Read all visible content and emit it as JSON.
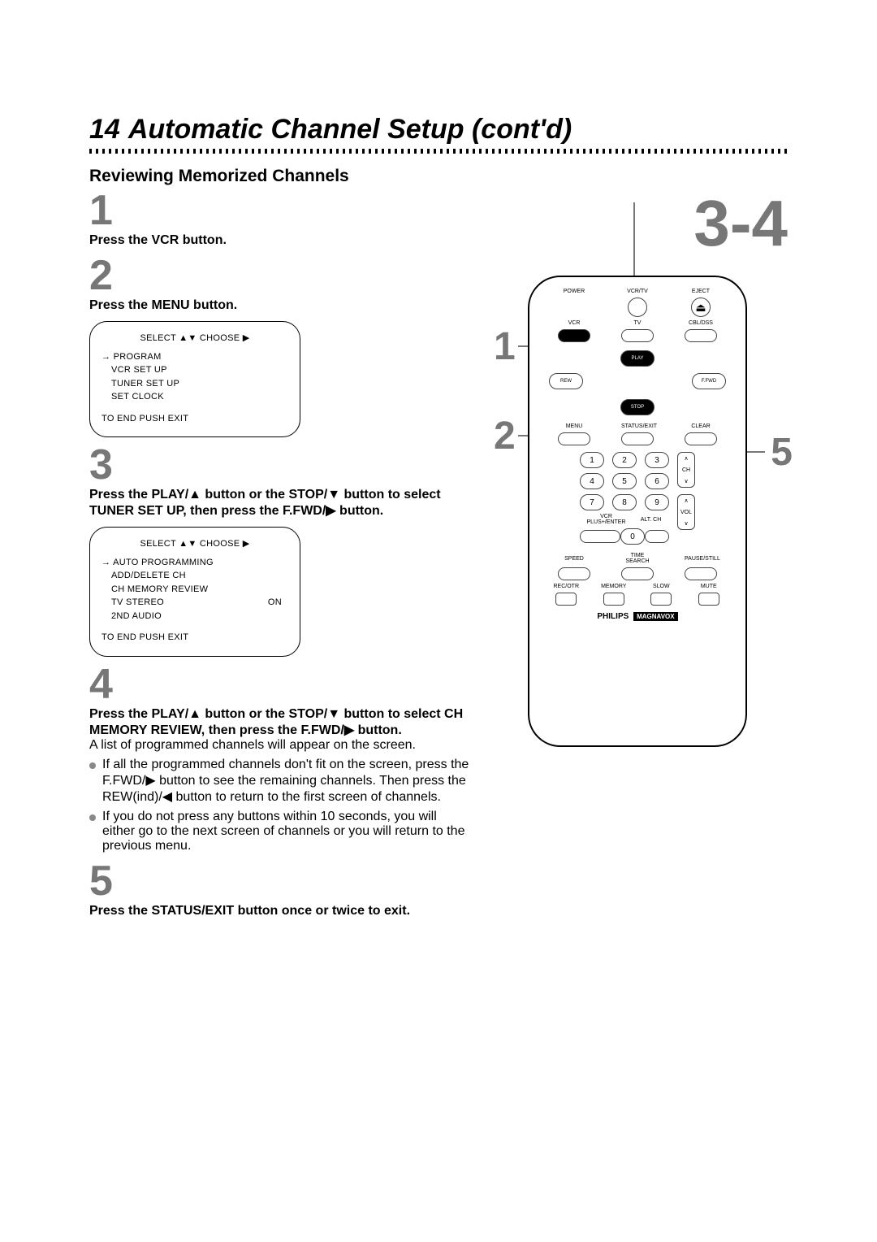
{
  "page": {
    "number": "14",
    "title": "Automatic Channel Setup (cont'd)",
    "subtitle": "Reviewing Memorized Channels",
    "right_big": "3-4"
  },
  "steps": {
    "s1": {
      "num": "1",
      "text": "Press the VCR button."
    },
    "s2": {
      "num": "2",
      "text": "Press the MENU button."
    },
    "s3": {
      "num": "3",
      "text": "Press the PLAY/▲ button or the STOP/▼ button to select TUNER SET UP, then press the F.FWD/▶ button."
    },
    "s4": {
      "num": "4",
      "text1": "Press the PLAY/▲ button or the STOP/▼ button to select CH MEMORY REVIEW, then press the F.FWD/▶ button.",
      "desc": "A list of programmed channels will appear on the screen.",
      "b1": "If all the programmed channels don't fit on the screen, press the F.FWD/▶ button to see the remaining channels. Then press the REW(ind)/◀ button to return to the first screen of channels.",
      "b2": "If you do not press any buttons within 10 seconds, you will either go to the next screen of channels or you will return to the previous menu."
    },
    "s5": {
      "num": "5",
      "text": "Press the STATUS/EXIT button once or twice to exit."
    }
  },
  "osd1": {
    "header": "SELECT ▲▼ CHOOSE ▶",
    "l1": "PROGRAM",
    "l2": "VCR SET UP",
    "l3": "TUNER SET UP",
    "l4": "SET CLOCK",
    "footer": "TO END PUSH EXIT"
  },
  "osd2": {
    "header": "SELECT ▲▼ CHOOSE ▶",
    "l1": "AUTO PROGRAMMING",
    "l2": "ADD/DELETE CH",
    "l3": "CH MEMORY REVIEW",
    "l4a": "TV STEREO",
    "l4b": "ON",
    "l5": "2ND AUDIO",
    "footer": "TO END PUSH EXIT"
  },
  "remote": {
    "labels": {
      "power": "POWER",
      "vcrtv": "VCR/TV",
      "eject": "EJECT",
      "vcr": "VCR",
      "tv": "TV",
      "cbldss": "CBL/DSS",
      "play": "PLAY",
      "rew": "REW",
      "ffwd": "F.FWD",
      "stop": "STOP",
      "menu": "MENU",
      "status": "STATUS/EXIT",
      "clear": "CLEAR",
      "ch": "CH",
      "vol": "VOL",
      "vcrplus": "VCR PLUS+/ENTER",
      "altch": "ALT. CH",
      "speed": "SPEED",
      "timesearch": "TIME SEARCH",
      "pause": "PAUSE/STILL",
      "rec": "REC/OTR",
      "memory": "MEMORY",
      "slow": "SLOW",
      "mute": "MUTE"
    },
    "brand1": "PHILIPS",
    "brand2": "MAGNAVOX",
    "nums": [
      "1",
      "2",
      "3",
      "4",
      "5",
      "6",
      "7",
      "8",
      "9",
      "0"
    ]
  },
  "callouts": {
    "c1": "1",
    "c2": "2",
    "c5": "5"
  }
}
